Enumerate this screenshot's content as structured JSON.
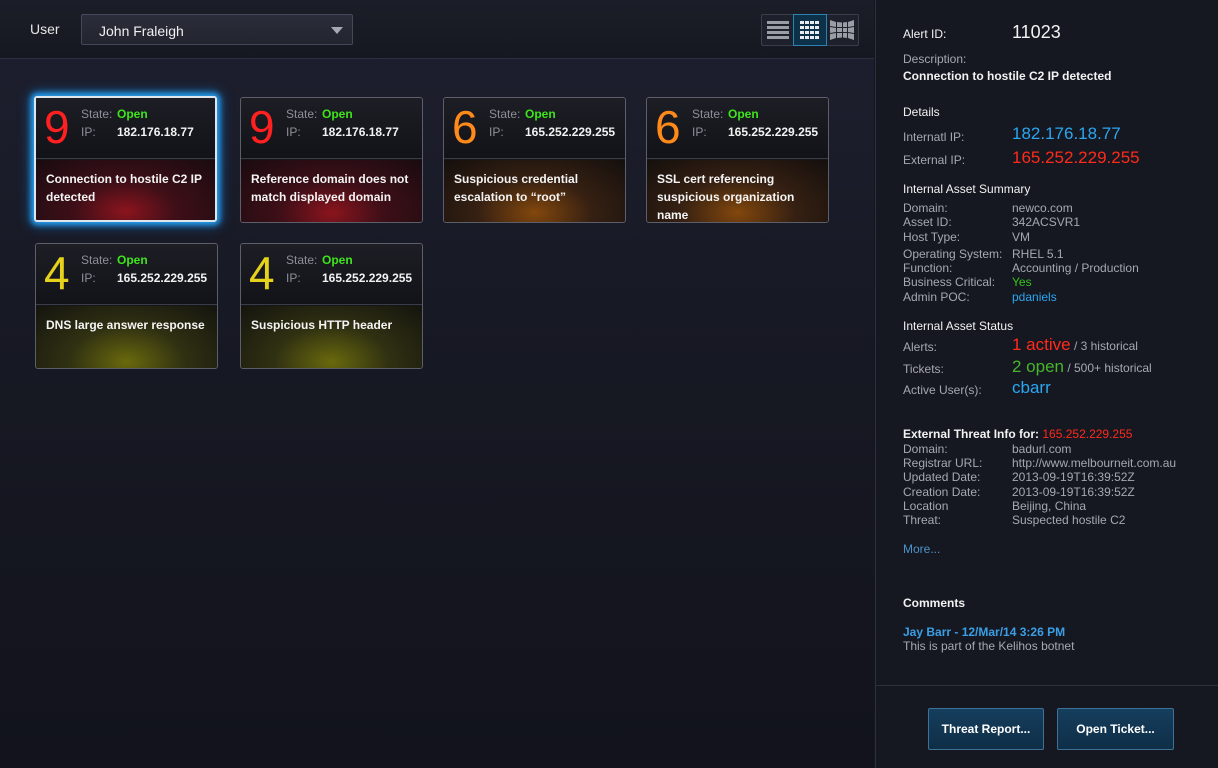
{
  "header": {
    "user_label": "User",
    "user_value": "John Fraleigh"
  },
  "view_modes": [
    "list-view-icon",
    "grid-view-icon",
    "wall-view-icon"
  ],
  "cards": [
    {
      "severity": "9",
      "state_label": "State:",
      "state": "Open",
      "ip_label": "IP:",
      "ip": "182.176.18.77",
      "description": "Connection to hostile C2 IP detected",
      "level": "red",
      "selected": true
    },
    {
      "severity": "9",
      "state_label": "State:",
      "state": "Open",
      "ip_label": "IP:",
      "ip": "182.176.18.77",
      "description": "Reference domain does not match displayed domain",
      "level": "red",
      "selected": false
    },
    {
      "severity": "6",
      "state_label": "State:",
      "state": "Open",
      "ip_label": "IP:",
      "ip": "165.252.229.255",
      "description": "Suspicious credential escalation to “root”",
      "level": "orange",
      "selected": false
    },
    {
      "severity": "6",
      "state_label": "State:",
      "state": "Open",
      "ip_label": "IP:",
      "ip": "165.252.229.255",
      "description": "SSL cert referencing suspicious organization name",
      "level": "orange",
      "selected": false
    },
    {
      "severity": "4",
      "state_label": "State:",
      "state": "Open",
      "ip_label": "IP:",
      "ip": "165.252.229.255",
      "description": "DNS large answer response",
      "level": "yellow",
      "selected": false
    },
    {
      "severity": "4",
      "state_label": "State:",
      "state": "Open",
      "ip_label": "IP:",
      "ip": "165.252.229.255",
      "description": "Suspicious HTTP header",
      "level": "yellow",
      "selected": false
    }
  ],
  "detail": {
    "alert_id_label": "Alert ID:",
    "alert_id": "11023",
    "description_label": "Description:",
    "description": "Connection to hostile C2 IP detected",
    "details_heading": "Details",
    "internal_ip_label": "Internatl IP:",
    "internal_ip": "182.176.18.77",
    "external_ip_label": "External IP:",
    "external_ip": "165.252.229.255",
    "asset_summary_heading": "Internal Asset Summary",
    "asset_summary": [
      {
        "label": "Domain:",
        "value": "newco.com"
      },
      {
        "label": "Asset ID:",
        "value": "342ACSVR1"
      },
      {
        "label": "Host Type:",
        "value": "VM"
      },
      {
        "label": "Operating System:",
        "value": "RHEL 5.1"
      },
      {
        "label": "Function:",
        "value": "Accounting / Production"
      },
      {
        "label": "Business Critical:",
        "value": "Yes"
      },
      {
        "label": "Admin POC:",
        "value": "pdaniels"
      }
    ],
    "asset_status_heading": "Internal Asset Status",
    "alerts_label": "Alerts:",
    "alerts_active": "1 active",
    "alerts_historical": "/ 3 historical",
    "tickets_label": "Tickets:",
    "tickets_open": "2 open",
    "tickets_historical": "/ 500+ historical",
    "active_users_label": "Active User(s):",
    "active_users": "cbarr",
    "threat_heading": "External Threat Info for:",
    "threat_ip": "165.252.229.255",
    "threat_info": [
      {
        "label": "Domain:",
        "value": "badurl.com"
      },
      {
        "label": "Registrar URL:",
        "value": "http://www.melbourneit.com.au"
      },
      {
        "label": "Updated Date:",
        "value": "2013-09-19T16:39:52Z"
      },
      {
        "label": "Creation Date:",
        "value": "2013-09-19T16:39:52Z"
      },
      {
        "label": "Location",
        "value": "Beijing, China"
      },
      {
        "label": "Threat:",
        "value": "Suspected hostile C2"
      }
    ],
    "more_link": "More...",
    "comments_heading": "Comments",
    "comment_author": "Jay Barr - 12/Mar/14 3:26 PM",
    "comment_text": "This is part of the Kelihos botnet"
  },
  "footer": {
    "threat_report_button": "Threat Report...",
    "open_ticket_button": "Open Ticket..."
  }
}
